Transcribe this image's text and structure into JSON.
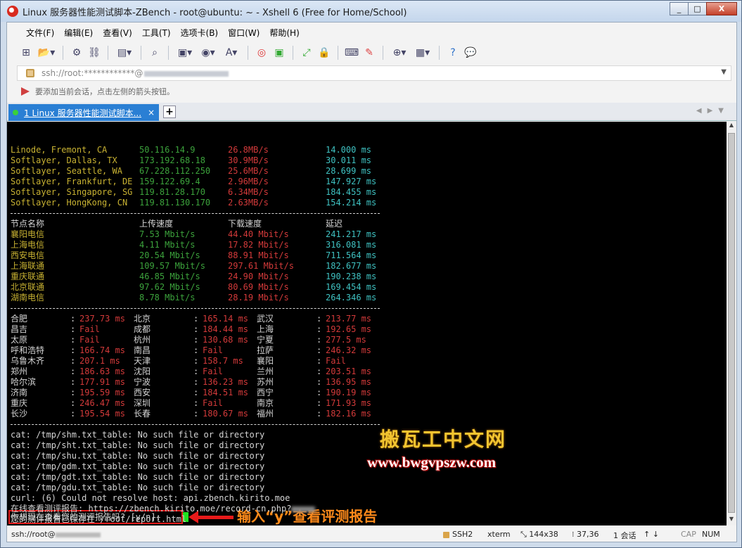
{
  "window": {
    "title": "Linux 服务器性能测试脚本-ZBench - root@ubuntu: ~ - Xshell 6 (Free for Home/School)",
    "minimize": "_",
    "maximize": "□",
    "close": "X"
  },
  "menu": [
    "文件(F)",
    "编辑(E)",
    "查看(V)",
    "工具(T)",
    "选项卡(B)",
    "窗口(W)",
    "帮助(H)"
  ],
  "address": {
    "value": "ssh://root:************@"
  },
  "hint": {
    "text": "要添加当前会话，点击左侧的箭头按钮。"
  },
  "tab": {
    "label": "1 Linux 服务器性能测试脚本...",
    "close": "×",
    "add": "+"
  },
  "terminal": {
    "speed_rows": [
      {
        "node": "Linode, Fremont, CA",
        "ip": "50.116.14.9",
        "speed": "26.8MB/s",
        "latency": "14.000 ms"
      },
      {
        "node": "Softlayer, Dallas, TX",
        "ip": "173.192.68.18",
        "speed": "30.9MB/s",
        "latency": "30.011 ms"
      },
      {
        "node": "Softlayer, Seattle, WA",
        "ip": "67.228.112.250",
        "speed": "25.6MB/s",
        "latency": "28.699 ms"
      },
      {
        "node": "Softlayer, Frankfurt, DE",
        "ip": "159.122.69.4",
        "speed": "2.96MB/s",
        "latency": "147.927 ms"
      },
      {
        "node": "Softlayer, Singapore, SG",
        "ip": "119.81.28.170",
        "speed": "6.34MB/s",
        "latency": "184.455 ms"
      },
      {
        "node": "Softlayer, HongKong, CN",
        "ip": "119.81.130.170",
        "speed": "2.63MB/s",
        "latency": "154.214 ms"
      }
    ],
    "cn_header": {
      "node": "节点名称",
      "up": "上传速度",
      "down": "下载速度",
      "latency": "延迟"
    },
    "cn_rows": [
      {
        "node": "襄阳电信",
        "up": "7.53 Mbit/s",
        "down": "44.40 Mbit/s",
        "latency": "241.217 ms"
      },
      {
        "node": "上海电信",
        "up": "4.11 Mbit/s",
        "down": "17.82 Mbit/s",
        "latency": "316.081 ms"
      },
      {
        "node": "西安电信",
        "up": "20.54 Mbit/s",
        "down": "88.91 Mbit/s",
        "latency": "711.564 ms"
      },
      {
        "node": "上海联通",
        "up": "109.57 Mbit/s",
        "down": "297.61 Mbit/s",
        "latency": "182.677 ms"
      },
      {
        "node": "重庆联通",
        "up": "46.85 Mbit/s",
        "down": "24.90 Mbit/s",
        "latency": "190.238 ms"
      },
      {
        "node": "北京联通",
        "up": "97.62 Mbit/s",
        "down": "80.69 Mbit/s",
        "latency": "169.454 ms"
      },
      {
        "node": "湖南电信",
        "up": "8.78 Mbit/s",
        "down": "28.19 Mbit/s",
        "latency": "264.346 ms"
      }
    ],
    "ping_rows": [
      [
        {
          "city": "合肥",
          "val": "237.73 ms"
        },
        {
          "city": "北京",
          "val": "165.14 ms"
        },
        {
          "city": "武汉",
          "val": "213.77 ms"
        }
      ],
      [
        {
          "city": "昌吉",
          "val": "Fail"
        },
        {
          "city": "成都",
          "val": "184.44 ms"
        },
        {
          "city": "上海",
          "val": "192.65 ms"
        }
      ],
      [
        {
          "city": "太原",
          "val": "Fail"
        },
        {
          "city": "杭州",
          "val": "130.68 ms"
        },
        {
          "city": "宁夏",
          "val": "277.5 ms"
        }
      ],
      [
        {
          "city": "呼和浩特",
          "val": "166.74 ms"
        },
        {
          "city": "南昌",
          "val": "Fail"
        },
        {
          "city": "拉萨",
          "val": "246.32 ms"
        }
      ],
      [
        {
          "city": "乌鲁木齐",
          "val": "207.1 ms"
        },
        {
          "city": "天津",
          "val": "158.7 ms"
        },
        {
          "city": "襄阳",
          "val": "Fail"
        }
      ],
      [
        {
          "city": "郑州",
          "val": "186.63 ms"
        },
        {
          "city": "沈阳",
          "val": "Fail"
        },
        {
          "city": "兰州",
          "val": "203.51 ms"
        }
      ],
      [
        {
          "city": "哈尔滨",
          "val": "177.91 ms"
        },
        {
          "city": "宁波",
          "val": "136.23 ms"
        },
        {
          "city": "苏州",
          "val": "136.95 ms"
        }
      ],
      [
        {
          "city": "济南",
          "val": "195.59 ms"
        },
        {
          "city": "西安",
          "val": "184.51 ms"
        },
        {
          "city": "西宁",
          "val": "190.19 ms"
        }
      ],
      [
        {
          "city": "重庆",
          "val": "246.47 ms"
        },
        {
          "city": "深圳",
          "val": "Fail"
        },
        {
          "city": "南京",
          "val": "171.93 ms"
        }
      ],
      [
        {
          "city": "长沙",
          "val": "195.54 ms"
        },
        {
          "city": "长春",
          "val": "180.67 ms"
        },
        {
          "city": "福州",
          "val": "182.16 ms"
        }
      ]
    ],
    "log_lines": [
      "cat: /tmp/shm.txt_table: No such file or directory",
      "cat: /tmp/sht.txt_table: No such file or directory",
      "cat: /tmp/shu.txt_table: No such file or directory",
      "cat: /tmp/gdm.txt_table: No such file or directory",
      "cat: /tmp/gdt.txt_table: No such file or directory",
      "cat: /tmp/gdu.txt_table: No such file or directory",
      "curl: (6) Could not resolve host: api.zbench.kirito.moe",
      "在线查看测评报告: https://zbench.kirito.moe/record-cn.php?",
      "您的测评报告已保存在 /root/report.html"
    ],
    "prompt": "你想现在查看您的测评报告吗? [y/n]:"
  },
  "annotation": {
    "text": "输入“y”查看评测报告"
  },
  "watermark": {
    "line1": "搬瓦工中文网",
    "line2": "www.bwgvpszw.com"
  },
  "status": {
    "conn": "ssh://root@",
    "protocol": "SSH2",
    "term": "xterm",
    "size": "144x38",
    "cursor": "37,36",
    "sessions": "1 会话",
    "cap": "CAP",
    "num": "NUM"
  },
  "colors": {
    "node": "#c8b232",
    "ip": "#3ca33c",
    "speed": "#d33a3a",
    "latency": "#3fc2c2",
    "tab": "#2a7fd4",
    "annotation": "#ff8a1a"
  }
}
